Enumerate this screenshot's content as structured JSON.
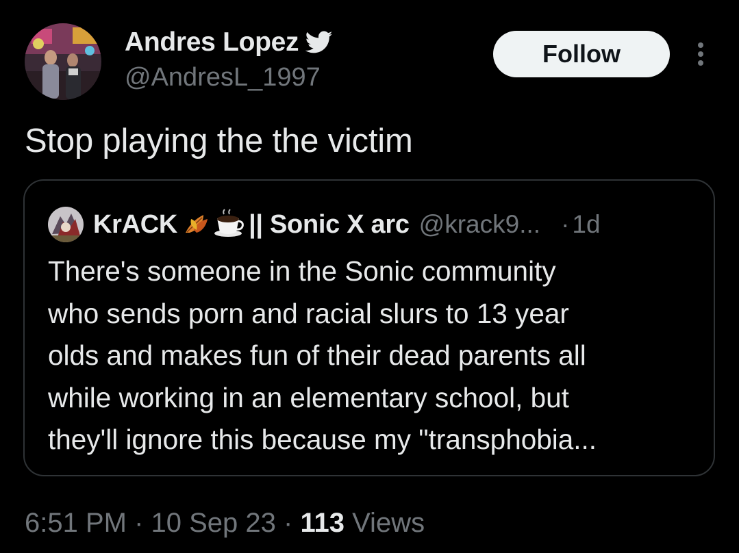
{
  "author": {
    "name": "Andres Lopez",
    "handle": "@AndresL_1997",
    "verified_icon": "twitter-bird-icon"
  },
  "follow_label": "Follow",
  "more_icon": "more-vertical-icon",
  "tweet_text": "Stop playing the the victim",
  "quote": {
    "name": "KrACK",
    "name_emojis": [
      "fallen-leaf-icon",
      "hot-beverage-icon"
    ],
    "name_suffix": "|| Sonic X arc",
    "handle": "@krack9...",
    "dot": "·",
    "time": "1d",
    "lines": [
      "There's someone in the Sonic community",
      "who sends porn and racial slurs to 13 year",
      "olds and makes fun of their dead parents all",
      "while working in an elementary school, but",
      "they'll ignore this because my \"transphobia..."
    ]
  },
  "meta": {
    "time": "6:51 PM",
    "sep1": " · ",
    "date": "10 Sep 23",
    "sep2": " · ",
    "views_count": "113",
    "views_label": " Views"
  },
  "colors": {
    "background": "#000000",
    "text_primary": "#e7e9ea",
    "text_secondary": "#71767b",
    "border": "#2f3336",
    "follow_bg": "#eff3f4"
  }
}
